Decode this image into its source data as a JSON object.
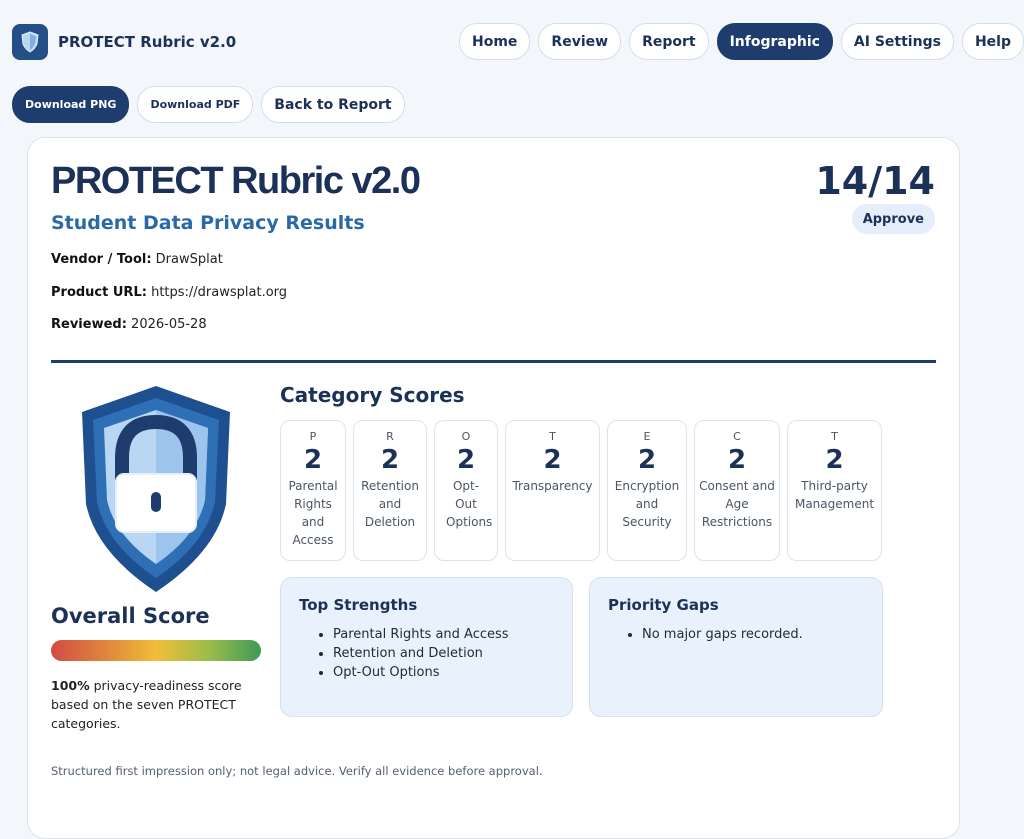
{
  "app": {
    "title": "PROTECT Rubric v2.0",
    "logo_icon": "shield-icon"
  },
  "nav": [
    {
      "label": "Home",
      "active": false
    },
    {
      "label": "Review",
      "active": false
    },
    {
      "label": "Report",
      "active": false
    },
    {
      "label": "Infographic",
      "active": true
    },
    {
      "label": "AI Settings",
      "active": false
    },
    {
      "label": "Help",
      "active": false
    }
  ],
  "actions": {
    "download_png": "Download PNG",
    "download_pdf": "Download PDF",
    "back": "Back to Report"
  },
  "report": {
    "title": "PROTECT Rubric v2.0",
    "subtitle": "Student Data Privacy Results",
    "vendor_label": "Vendor / Tool:",
    "vendor": "DrawSplat",
    "url_label": "Product URL:",
    "url": "https://drawsplat.org",
    "reviewed_label": "Reviewed:",
    "reviewed": "2026-05-28",
    "score": "14/14",
    "verdict": "Approve"
  },
  "overall": {
    "title": "Overall Score",
    "percent": "100%",
    "description": "privacy-readiness score based on the seven PROTECT categories.",
    "fraction": 1.0
  },
  "categories": {
    "title": "Category Scores",
    "items": [
      {
        "letter": "P",
        "score": "2",
        "name": "Parental Rights and Access"
      },
      {
        "letter": "R",
        "score": "2",
        "name": "Retention and Deletion"
      },
      {
        "letter": "O",
        "score": "2",
        "name": "Opt-Out Options"
      },
      {
        "letter": "T",
        "score": "2",
        "name": "Transparency"
      },
      {
        "letter": "E",
        "score": "2",
        "name": "Encryption and Security"
      },
      {
        "letter": "C",
        "score": "2",
        "name": "Consent and Age Restrictions"
      },
      {
        "letter": "T",
        "score": "2",
        "name": "Third-party Management"
      }
    ]
  },
  "strengths": {
    "title": "Top Strengths",
    "items": [
      "Parental Rights and Access",
      "Retention and Deletion",
      "Opt-Out Options"
    ]
  },
  "gaps": {
    "title": "Priority Gaps",
    "items": [
      "No major gaps recorded."
    ]
  },
  "footnote": "Structured first impression only; not legal advice. Verify all evidence before approval.",
  "colors": {
    "primary": "#1e3d6e",
    "accent": "#2a69a8",
    "panel": "#e8f1fc"
  }
}
